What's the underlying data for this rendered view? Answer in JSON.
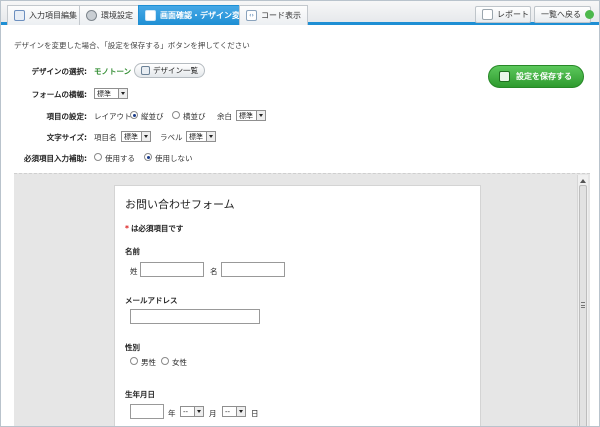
{
  "tabs": [
    {
      "label": "入力項目編集",
      "icon": "form-edit-icon",
      "active": false
    },
    {
      "label": "環境設定",
      "icon": "gear-icon",
      "active": false
    },
    {
      "label": "画面確認・デザイン変更",
      "icon": "design-screen-icon",
      "active": true
    },
    {
      "label": "コード表示",
      "icon": "code-icon",
      "active": false
    }
  ],
  "header_buttons": {
    "report": {
      "label": "レポート",
      "icon": "report-icon"
    },
    "back": {
      "label": "一覧へ戻る",
      "icon": "back-arrow-icon"
    }
  },
  "notice": "デザインを変更した場合、「設定を保存する」ボタンを押してください",
  "settings": {
    "design_label": "デザインの選択:",
    "design_value": "モノトーン",
    "design_list_button": "デザイン一覧",
    "form_width_label": "フォームの横幅:",
    "form_width_value": "標準",
    "item_label": "項目の設定:",
    "layout_text": "レイアウト",
    "vertical_text": "縦並び",
    "horizontal_text": "横並び",
    "margin_text": "余白",
    "margin_value": "標準",
    "font_size_label": "文字サイズ:",
    "item_name_text": "項目名",
    "item_name_value": "標準",
    "label_text": "ラベル",
    "label_value": "標準",
    "required_label": "必須項目入力補助:",
    "use_text": "使用する",
    "nouse_text": "使用しない"
  },
  "save_button": "設定を保存する",
  "preview": {
    "form_title": "お問い合わせフォーム",
    "required_star": "*",
    "required_note": "は必須項目です",
    "name_label": "名前",
    "sei": "姓",
    "mei": "名",
    "email_label": "メールアドレス",
    "gender_label": "性別",
    "male": "男性",
    "female": "女性",
    "birth_label": "生年月日",
    "year": "年",
    "month": "月",
    "day": "日",
    "dash": "--"
  },
  "colors": {
    "accent": "#1e8fd4",
    "save_green": "#3aa83a",
    "design_value": "#2e8b2e"
  }
}
